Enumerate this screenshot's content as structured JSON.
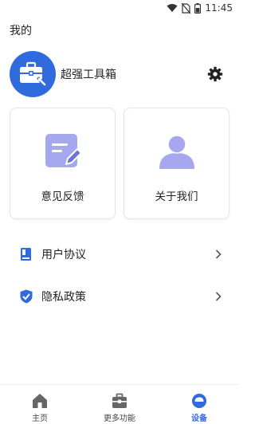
{
  "status_bar": {
    "time": "11:45",
    "icons": [
      "wifi-icon",
      "no-sim-icon",
      "battery-icon"
    ]
  },
  "header": {
    "title": "我的"
  },
  "profile": {
    "name": "超强工具箱",
    "avatar_icon": "toolbox-icon",
    "settings_icon": "gear-icon"
  },
  "cards": [
    {
      "label": "意见反馈",
      "icon": "feedback-icon"
    },
    {
      "label": "关于我们",
      "icon": "person-icon"
    }
  ],
  "menu": [
    {
      "label": "用户协议",
      "icon": "document-icon"
    },
    {
      "label": "隐私政策",
      "icon": "shield-check-icon"
    }
  ],
  "tabs": [
    {
      "label": "主页",
      "icon": "home-icon",
      "active": false
    },
    {
      "label": "更多功能",
      "icon": "toolbox-icon",
      "active": false
    },
    {
      "label": "设备",
      "icon": "device-icon",
      "active": true
    }
  ],
  "colors": {
    "accent": "#2f6bdc",
    "card_icon": "#a5a8ee"
  }
}
